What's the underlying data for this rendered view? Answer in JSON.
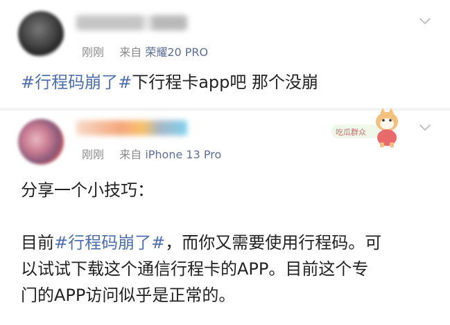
{
  "post1": {
    "meta": {
      "time": "刚刚",
      "via": "来自",
      "device": "荣耀20 PRO"
    },
    "content": {
      "tag": "#行程码崩了#",
      "rest": "下行程卡app吧 那个没崩"
    }
  },
  "post2": {
    "meta": {
      "time": "刚刚",
      "via": "来自",
      "device": "iPhone 13 Pro"
    },
    "content": {
      "intro": "分享一个小技巧：",
      "line1_prefix": "目前",
      "line1_tag": "#行程码崩了#",
      "line1_suffix": "，而你又需要使用行程码。可",
      "line2": "以试试下载这个通信行程卡的APP。目前这个专",
      "line3": "门的APP访问似乎是正常的。"
    },
    "sticker_text": "吃瓜群众"
  },
  "icons": {
    "menu": "chevron-down-icon"
  }
}
